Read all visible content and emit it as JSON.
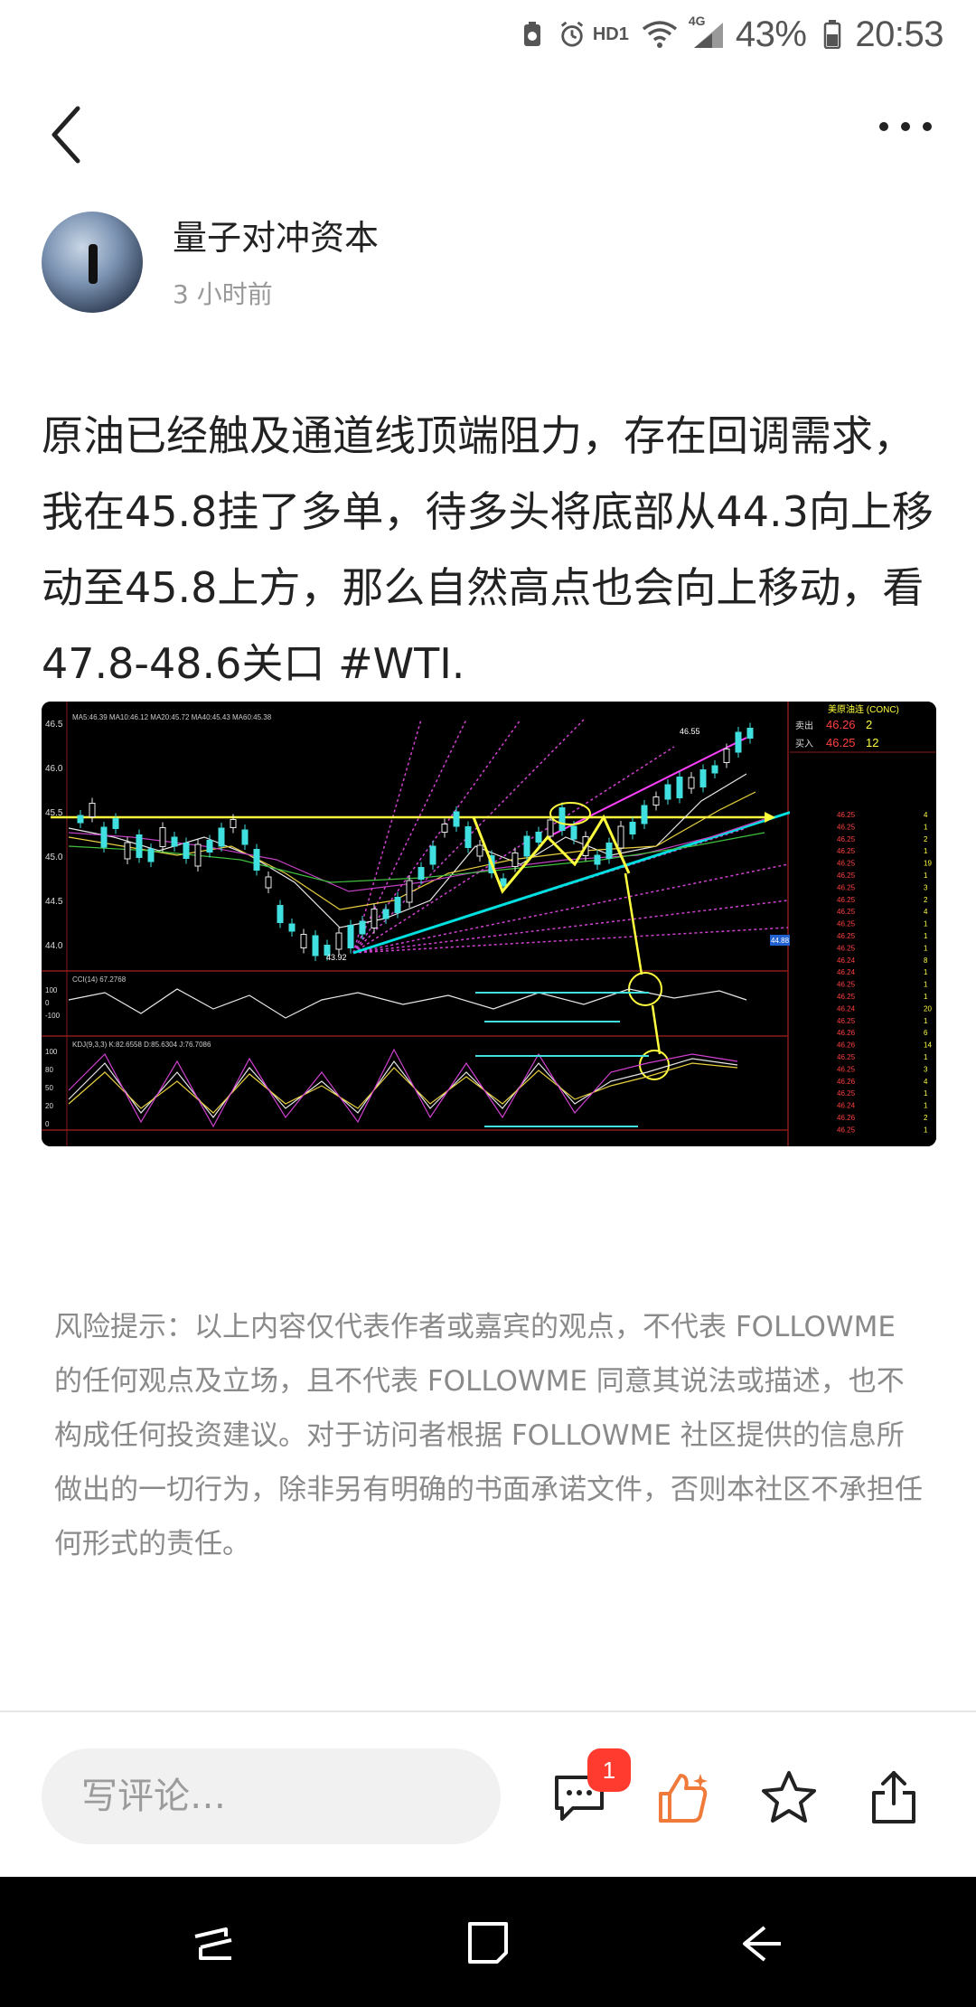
{
  "status_bar": {
    "hd_label": "HD1",
    "network_label": "4G",
    "battery": "43%",
    "time": "20:53"
  },
  "nav": {
    "back_icon": "chevron-left-icon",
    "more_icon": "more-dots-icon"
  },
  "author": {
    "name": "量子对冲资本",
    "time": "3 小时前"
  },
  "post": {
    "text": "原油已经触及通道线顶端阻力，存在回调需求，我在45.8挂了多单，待多头将底部从44.3向上移动至45.8上方，那么自然高点也会向上移动，看47.8-48.6关口 #WTI."
  },
  "chart": {
    "panel_title": "美原油连 (CONC)",
    "sell_label": "卖出",
    "sell_price": "46.26",
    "sell_qty": "2",
    "buy_label": "买入",
    "buy_price": "46.25",
    "buy_qty": "12",
    "price_axis": [
      "46.5",
      "46.0",
      "45.5",
      "45.0",
      "44.5",
      "44.0"
    ],
    "low_label": "43.92",
    "high_label": "46.55",
    "current_price_tag": "44.88",
    "ma_label": "MA5:46.39 MA10:46.12 MA20:45.72 MA40:45.43 MA60:45.38",
    "cci_label": "CCI(14) 67.2768",
    "kdj_label": "KDJ(9,3,3) K:82.6558 D:85.6304 J:76.7086",
    "cci_axis": [
      "100",
      "0",
      "-100"
    ],
    "kdj_axis": [
      "100",
      "80",
      "50",
      "20",
      "0"
    ],
    "tick_prices": [
      "46.25",
      "46.25",
      "46.25",
      "46.25",
      "46.25",
      "46.25",
      "46.25",
      "46.25",
      "46.25",
      "46.25",
      "46.25",
      "46.25",
      "46.24",
      "46.24",
      "46.25",
      "46.25",
      "46.24",
      "46.25",
      "46.26",
      "46.26",
      "46.25",
      "46.25",
      "46.26",
      "46.25",
      "46.24",
      "46.26",
      "46.25"
    ],
    "tick_qty": [
      "4",
      "1",
      "2",
      "1",
      "19",
      "1",
      "3",
      "2",
      "4",
      "1",
      "1",
      "1",
      "8",
      "1",
      "1",
      "1",
      "20",
      "1",
      "6",
      "14",
      "1",
      "3",
      "4",
      "1",
      "1",
      "2",
      "1"
    ]
  },
  "risk": {
    "text": "风险提示：以上内容仅代表作者或嘉宾的观点，不代表 FOLLOWME 的任何观点及立场，且不代表 FOLLOWME 同意其说法或描述，也不构成任何投资建议。对于访问者根据 FOLLOWME 社区提供的信息所做出的一切行为，除非另有明确的书面承诺文件，否则本社区不承担任何形式的责任。"
  },
  "bottom_bar": {
    "comment_placeholder": "写评论…",
    "comment_count_badge": "1",
    "accent_color": "#f07a3a",
    "badge_color": "#ff3b30"
  }
}
